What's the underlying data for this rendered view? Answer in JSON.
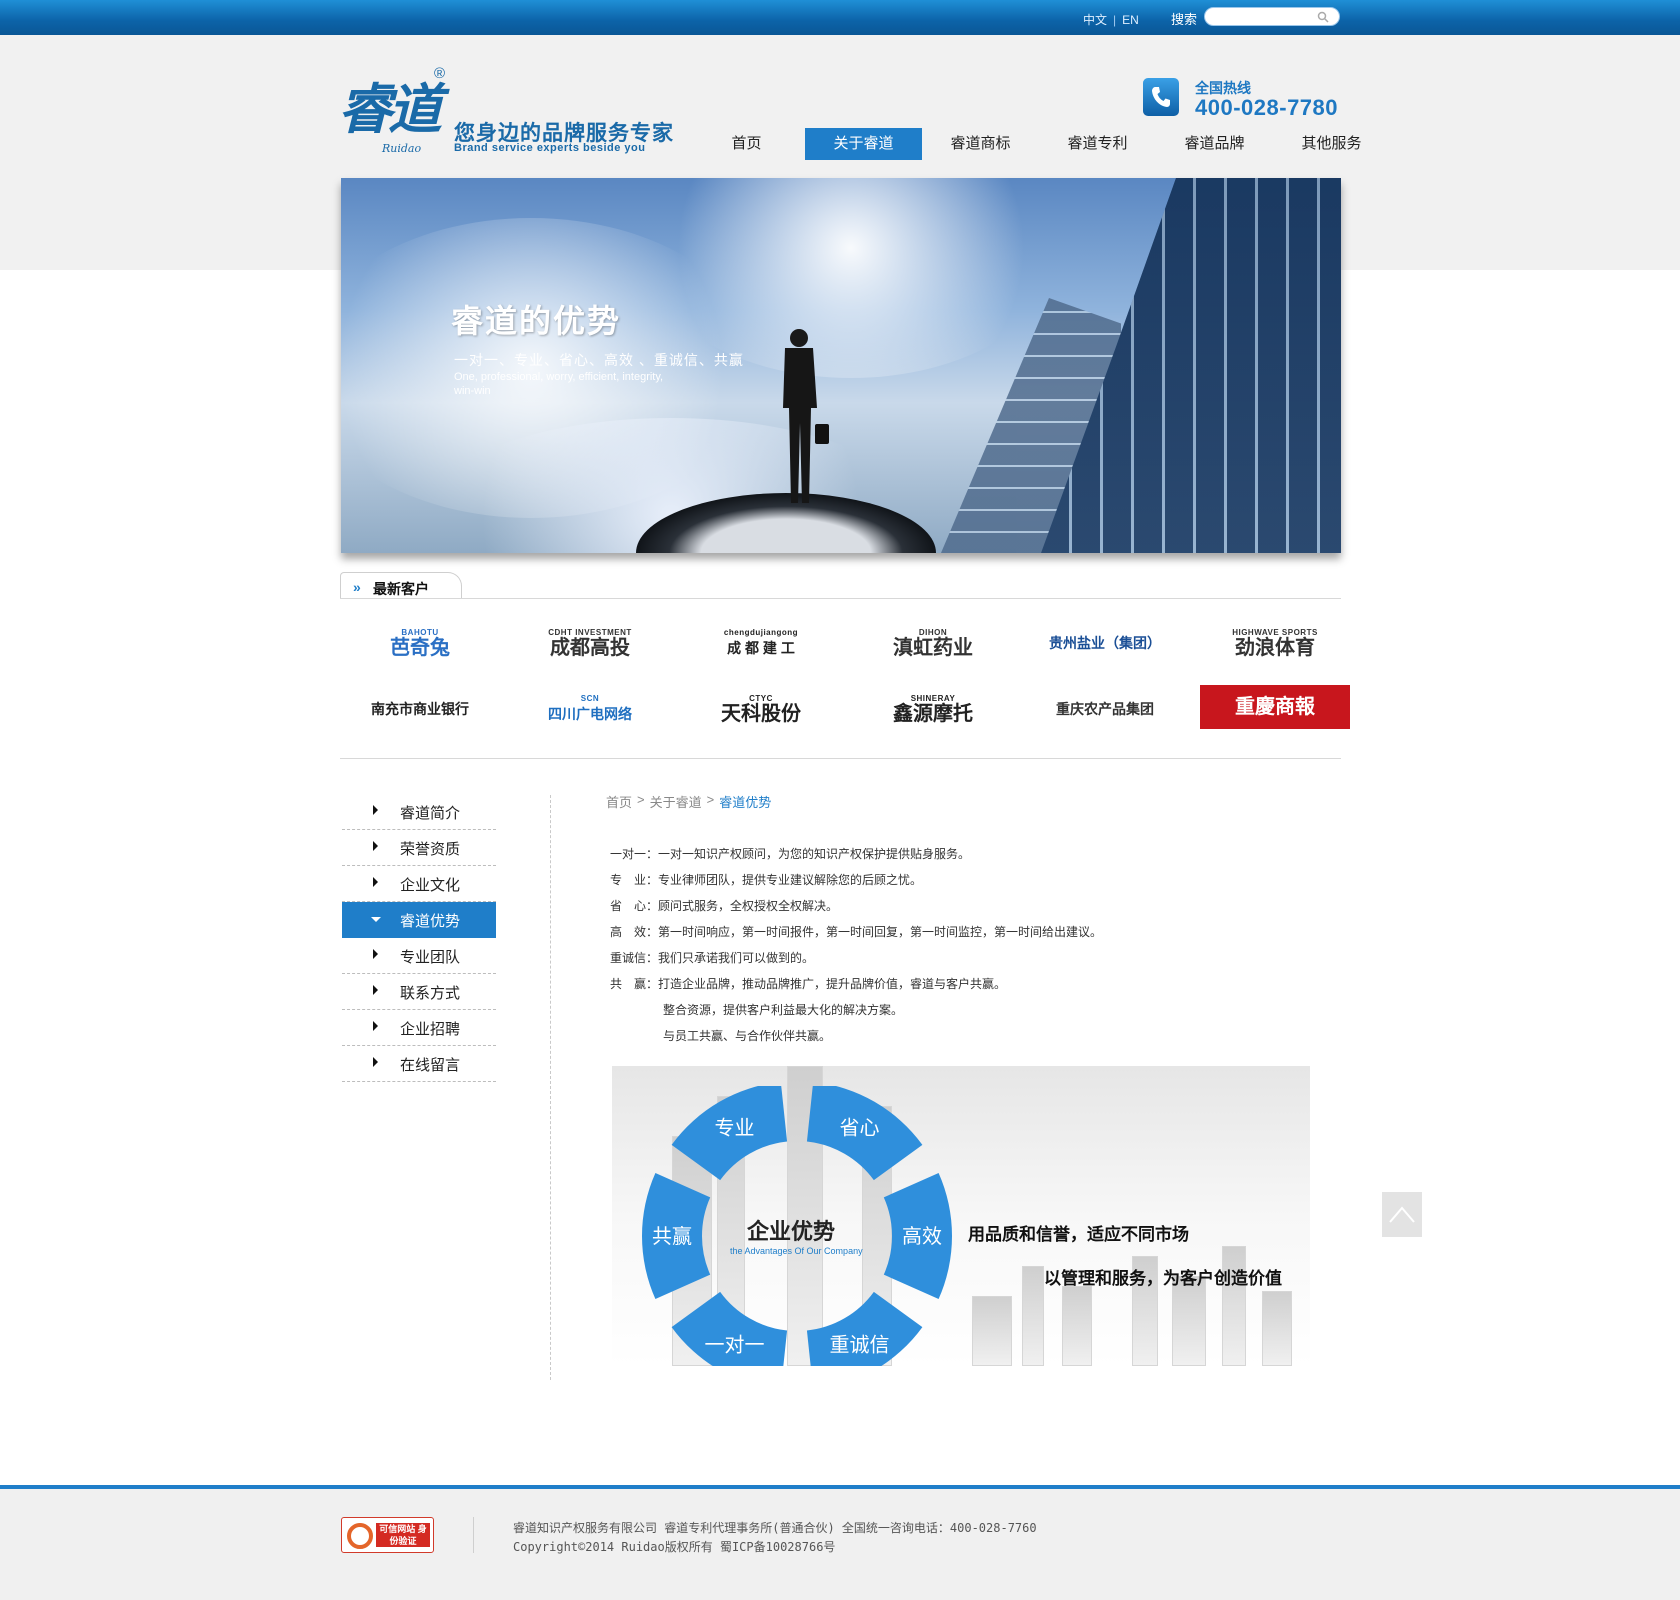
{
  "topbar": {
    "lang_zh": "中文",
    "lang_sep": "|",
    "lang_en": "EN",
    "search_label": "搜索",
    "search_placeholder": ""
  },
  "logo": {
    "mark": "睿道",
    "registered": "®",
    "script": "Ruidao",
    "slogan": "您身边的品牌服务专家",
    "slogan_en": "Brand service experts beside you"
  },
  "hotline": {
    "label": "全国热线",
    "number": "400-028-7780"
  },
  "nav": {
    "items": [
      {
        "label": "首页"
      },
      {
        "label": "关于睿道"
      },
      {
        "label": "睿道商标"
      },
      {
        "label": "睿道专利"
      },
      {
        "label": "睿道品牌"
      },
      {
        "label": "其他服务"
      }
    ],
    "active_index": 1
  },
  "banner": {
    "title": "睿道的优势",
    "tagline": "一对一、专业、省心、高效 、重诚信、共赢",
    "tagline_en": "One, professional, worry, efficient, integrity, win-win"
  },
  "clients": {
    "title": "最新客户",
    "logos": [
      {
        "name": "芭奇兔",
        "en": "BAHOTU",
        "color": "#2a6fc4"
      },
      {
        "name": "成都高投",
        "en": "CDHT INVESTMENT",
        "color": "#333333"
      },
      {
        "name": "成 都 建 工",
        "en": "chengdujiangong",
        "color": "#222222"
      },
      {
        "name": "滇虹药业",
        "en": "DIHON",
        "color": "#333333"
      },
      {
        "name": "贵州盐业（集团）",
        "en": "",
        "color": "#1b4f96"
      },
      {
        "name": "劲浪体育",
        "en": "HIGHWAVE SPORTS",
        "color": "#333333"
      },
      {
        "name": "南充市商业银行",
        "en": "",
        "color": "#222222"
      },
      {
        "name": "四川广电网络",
        "en": "SCN",
        "color": "#1f6fc0"
      },
      {
        "name": "天科股份",
        "en": "CTYC",
        "color": "#222222"
      },
      {
        "name": "鑫源摩托",
        "en": "SHINERAY",
        "color": "#222222"
      },
      {
        "name": "重庆农产品集团",
        "en": "",
        "color": "#333333"
      },
      {
        "name": "重慶商報",
        "en": "",
        "color": "#ffffff"
      }
    ]
  },
  "sidebar": {
    "items": [
      {
        "label": "睿道简介"
      },
      {
        "label": "荣誉资质"
      },
      {
        "label": "企业文化"
      },
      {
        "label": "睿道优势"
      },
      {
        "label": "专业团队"
      },
      {
        "label": "联系方式"
      },
      {
        "label": "企业招聘"
      },
      {
        "label": "在线留言"
      }
    ],
    "active_index": 3
  },
  "breadcrumb": {
    "home": "首页",
    "sep": ">",
    "section": "关于睿道",
    "current": "睿道优势"
  },
  "content": {
    "rows": [
      {
        "k": "一对一",
        "v": "：一对一知识产权顾问，为您的知识产权保护提供贴身服务。"
      },
      {
        "k": "专　业",
        "v": "：专业律师团队，提供专业建议解除您的后顾之忧。"
      },
      {
        "k": "省　心",
        "v": "：顾问式服务，全权授权全权解决。"
      },
      {
        "k": "高　效",
        "v": "：第一时间响应，第一时间报件，第一时间回复，第一时间监控，第一时间给出建议。"
      },
      {
        "k": "重诚信",
        "v": "：我们只承诺我们可以做到的。"
      },
      {
        "k": "共　赢",
        "v": "：打造企业品牌，推动品牌推广，提升品牌价值，睿道与客户共赢。"
      }
    ],
    "cont_rows": [
      "整合资源，提供客户利益最大化的解决方案。",
      "与员工共赢、与合作伙伴共赢。"
    ]
  },
  "diagram": {
    "segments": [
      "专业",
      "省心",
      "高效",
      "重诚信",
      "一对一",
      "共赢"
    ],
    "center_title": "企业优势",
    "center_sub": "the Advantages Of Our Company",
    "line1": "用品质和信誉，适应不同市场",
    "line2": "以管理和服务，为客户创造价值",
    "segment_color": "#2f8fdc"
  },
  "footer": {
    "line1": "睿道知识产权服务有限公司 睿道专利代理事务所(普通合伙) 全国统一咨询电话：400-028-7760",
    "line2": "Copyright©2014 Ruidao版权所有 蜀ICP备10028766号",
    "badge_text": "可信网站 身份验证"
  },
  "colors": {
    "brand_blue": "#1f7ec9",
    "topbar_blue": "#0c63a8"
  }
}
